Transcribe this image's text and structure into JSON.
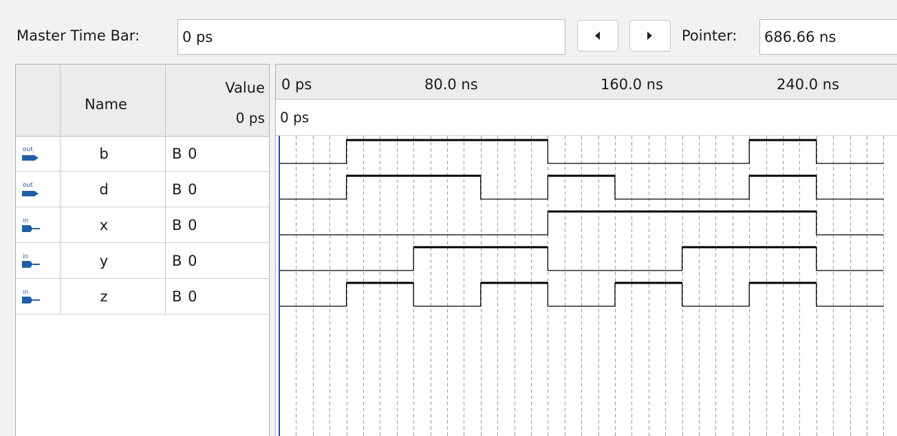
{
  "toolbar": {
    "master_time_bar_label": "Master Time Bar:",
    "master_time_bar_value": "0 ps",
    "pointer_label": "Pointer:",
    "pointer_value": "686.66 ns"
  },
  "grid": {
    "header_name": "Name",
    "header_value": "Value",
    "header_value_time": "0 ps",
    "rows": [
      {
        "direction": "out",
        "name": "b",
        "value": "B 0"
      },
      {
        "direction": "out",
        "name": "d",
        "value": "B 0"
      },
      {
        "direction": "in",
        "name": "x",
        "value": "B 0"
      },
      {
        "direction": "in",
        "name": "y",
        "value": "B 0"
      },
      {
        "direction": "in",
        "name": "z",
        "value": "B 0"
      }
    ]
  },
  "timeline": {
    "tick_labels": [
      "0 ps",
      "80.0 ns",
      "160.0 ns",
      "240.0 ns"
    ],
    "cursor_time_label": "0 ps",
    "colors": {
      "cursor": "#1f3fd6",
      "wave": "#000000",
      "grid": "#9a9a9a"
    }
  },
  "waveforms": {
    "time_unit": "ns",
    "step_ns": 40,
    "b": [
      0,
      1,
      1,
      1,
      0,
      0,
      0,
      1,
      0
    ],
    "d": [
      0,
      1,
      1,
      0,
      1,
      0,
      0,
      1,
      0
    ],
    "x": [
      0,
      0,
      0,
      0,
      1,
      1,
      1,
      1,
      0
    ],
    "y": [
      0,
      0,
      1,
      1,
      0,
      0,
      1,
      1,
      0
    ],
    "z": [
      0,
      1,
      0,
      1,
      0,
      1,
      0,
      1,
      0
    ]
  }
}
